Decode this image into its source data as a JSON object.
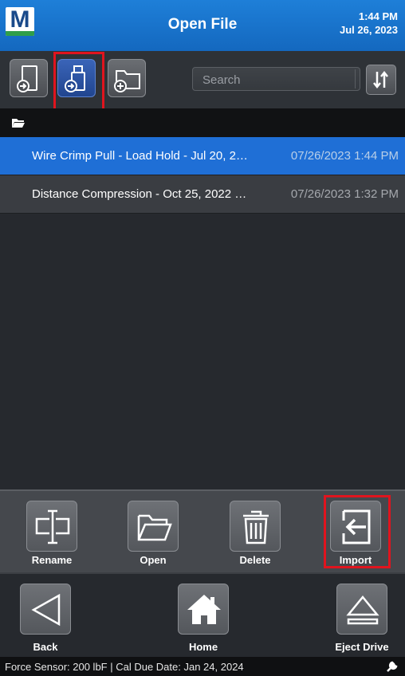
{
  "header": {
    "title": "Open File",
    "time": "1:44 PM",
    "date": "Jul 26, 2023",
    "logo_letter": "M"
  },
  "toolbar": {
    "sources": [
      {
        "name": "device-storage",
        "icon": "device-arrow-icon",
        "active": false
      },
      {
        "name": "usb-drive",
        "icon": "usb-drive-icon",
        "active": true
      },
      {
        "name": "new-folder",
        "icon": "folder-plus-icon",
        "active": false
      }
    ],
    "search_placeholder": "Search",
    "sort_icon": "sort-arrows-icon"
  },
  "pathbar": {
    "icon": "folder-open-icon"
  },
  "files": [
    {
      "name": "Wire Crimp Pull - Load Hold - Jul 20, 2…",
      "date": "07/26/2023 1:44 PM",
      "selected": true
    },
    {
      "name": "Distance Compression - Oct 25, 2022 …",
      "date": "07/26/2023 1:32 PM",
      "selected": false
    }
  ],
  "actions": {
    "rename": "Rename",
    "open": "Open",
    "delete": "Delete",
    "import": "Import"
  },
  "nav": {
    "back": "Back",
    "home": "Home",
    "eject": "Eject Drive"
  },
  "status": {
    "text": "Force Sensor: 200 lbF   |  Cal Due Date: Jan 24, 2024",
    "icon": "wrench-icon"
  },
  "colors": {
    "header": "#1a73cf",
    "selected_row": "#1f6fd6",
    "highlight": "#e0141e"
  }
}
